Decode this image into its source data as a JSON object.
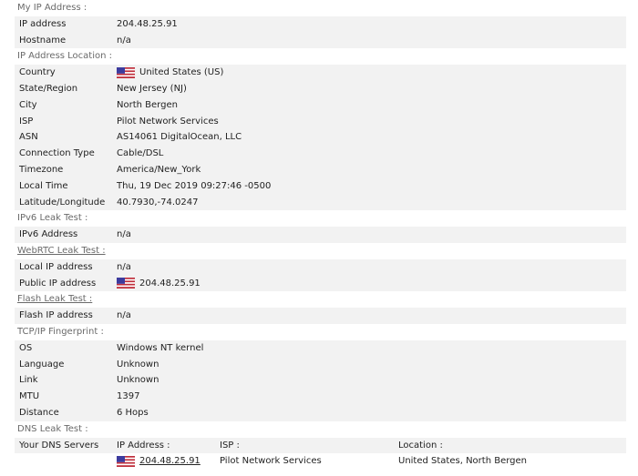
{
  "sections": {
    "my_ip": "My IP Address :",
    "location": "IP Address Location :",
    "ipv6": "IPv6 Leak Test :",
    "webrtc": "WebRTC Leak Test :",
    "flash": "Flash Leak Test :",
    "tcp": "TCP/IP Fingerprint :",
    "dns": "DNS Leak Test :"
  },
  "my_ip": [
    {
      "label": "IP address",
      "value": "204.48.25.91"
    },
    {
      "label": "Hostname",
      "value": "n/a"
    }
  ],
  "location": [
    {
      "label": "Country",
      "value": "United States (US)",
      "flag": "us-flag-icon"
    },
    {
      "label": "State/Region",
      "value": "New Jersey (NJ)"
    },
    {
      "label": "City",
      "value": "North Bergen"
    },
    {
      "label": "ISP",
      "value": "Pilot Network Services"
    },
    {
      "label": "ASN",
      "value": "AS14061 DigitalOcean, LLC"
    },
    {
      "label": "Connection Type",
      "value": "Cable/DSL"
    },
    {
      "label": "Timezone",
      "value": "America/New_York"
    },
    {
      "label": "Local Time",
      "value": "Thu, 19 Dec 2019 09:27:46 -0500"
    },
    {
      "label": "Latitude/Longitude",
      "value": "40.7930,-74.0247"
    }
  ],
  "ipv6": [
    {
      "label": "IPv6 Address",
      "value": "n/a"
    }
  ],
  "webrtc": [
    {
      "label": "Local IP address",
      "value": "n/a"
    },
    {
      "label": "Public IP address",
      "value": "204.48.25.91",
      "flag": "us-flag-icon"
    }
  ],
  "flash": [
    {
      "label": "Flash IP address",
      "value": "n/a"
    }
  ],
  "tcp": [
    {
      "label": "OS",
      "value": "Windows NT kernel"
    },
    {
      "label": "Language",
      "value": "Unknown"
    },
    {
      "label": "Link",
      "value": "Unknown"
    },
    {
      "label": "MTU",
      "value": "1397"
    },
    {
      "label": "Distance",
      "value": "6 Hops"
    }
  ],
  "dns": {
    "label": "Your DNS Servers",
    "headers": {
      "ip": "IP Address :",
      "isp": "ISP :",
      "location": "Location :"
    },
    "servers": [
      {
        "ip": "204.48.25.91",
        "isp": "Pilot Network Services",
        "location": "United States, North Bergen",
        "flag": "us-flag-icon"
      }
    ]
  },
  "colors": {
    "stripe": "#f2f2f2",
    "section_text": "#6a6a6a"
  }
}
